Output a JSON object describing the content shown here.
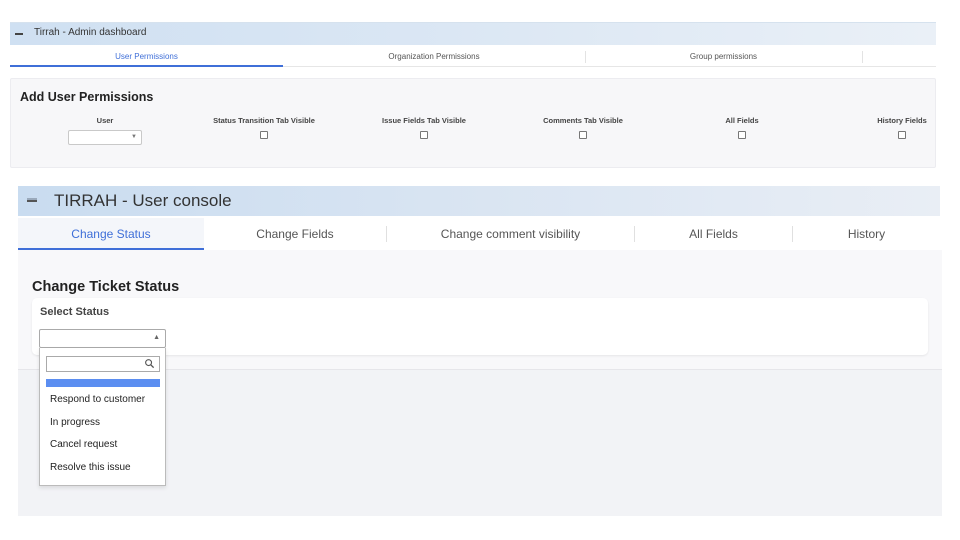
{
  "admin": {
    "title": "Tirrah - Admin dashboard",
    "tabs": [
      {
        "label": "User Permissions",
        "active": true
      },
      {
        "label": "Organization Permissions",
        "active": false
      },
      {
        "label": "Group permissions",
        "active": false
      }
    ],
    "section_title": "Add User Permissions",
    "columns": [
      "User",
      "Status Transition Tab Visible",
      "Issue Fields Tab Visible",
      "Comments Tab Visible",
      "All Fields",
      "History Fields"
    ],
    "user_value": "",
    "checkboxes_checked": [
      false,
      false,
      false,
      false,
      false
    ]
  },
  "console": {
    "title": "TIRRAH - User console",
    "tabs": [
      {
        "label": "Change Status",
        "active": true
      },
      {
        "label": "Change Fields",
        "active": false
      },
      {
        "label": "Change comment visibility",
        "active": false
      },
      {
        "label": "All Fields",
        "active": false
      },
      {
        "label": "History",
        "active": false
      }
    ],
    "section_title": "Change Ticket Status",
    "select_label": "Select Status",
    "select_value": "",
    "search_value": "",
    "options": [
      "Respond to customer",
      "In progress",
      "Cancel request",
      "Resolve this issue"
    ]
  },
  "colors": {
    "accent": "#3f6fd8",
    "highlight": "#5b8ef1",
    "header_gradient_start": "#c9dcf0"
  },
  "icons": {
    "collapse": "minus-icon",
    "caret_down": "chevron-down-icon",
    "caret_up": "chevron-up-icon",
    "search": "search-icon"
  }
}
